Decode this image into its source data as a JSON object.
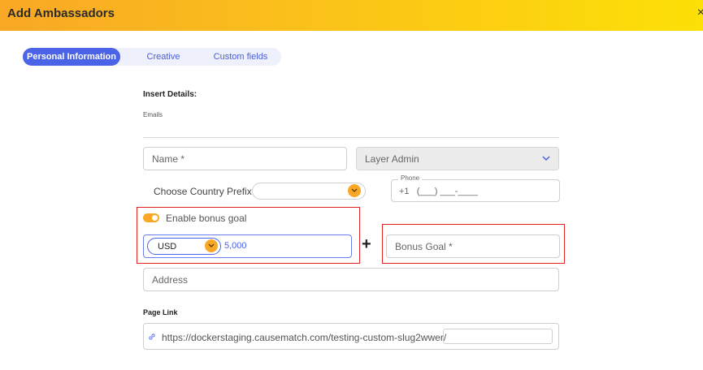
{
  "window": {
    "title": "Add Ambassadors",
    "close_symbol": "×"
  },
  "tabs": [
    {
      "label": "Personal Information",
      "active": true
    },
    {
      "label": "Creative",
      "active": false
    },
    {
      "label": "Custom fields",
      "active": false
    }
  ],
  "form": {
    "section_title": "Insert Details:",
    "emails_label": "Emails",
    "name_placeholder": "Name *",
    "layer_select_value": "Layer Admin",
    "country_prefix_label": "Choose Country Prefix",
    "phone_label": "Phone",
    "phone_prefix": "+1",
    "phone_mask": "(___) ___-____",
    "bonus_toggle_label": "Enable bonus goal",
    "bonus_enabled": true,
    "currency": "USD",
    "amount": "5,000",
    "plus_symbol": "+",
    "bonus_goal_placeholder": "Bonus Goal *",
    "address_placeholder": "Address",
    "page_link_label": "Page Link",
    "page_link_url": "https://dockerstaging.causematch.com/testing-custom-slug2wwer/"
  },
  "colors": {
    "accent": "#4a63e7",
    "orange": "#f9a825",
    "highlight": "#e02424"
  }
}
